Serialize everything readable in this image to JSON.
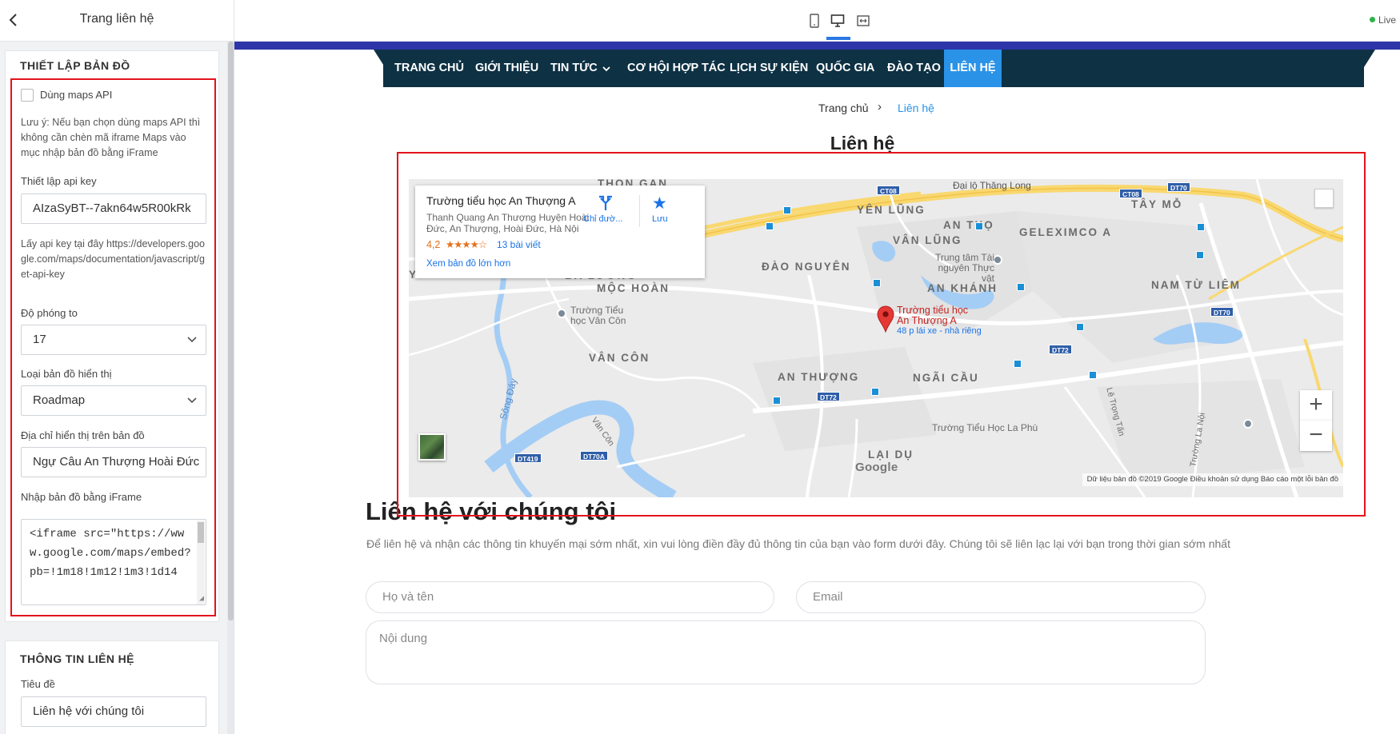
{
  "left_panel": {
    "back_icon": "chevron-left-icon",
    "title": "Trang liên hệ",
    "map_settings": {
      "title": "THIẾT LẬP BẢN ĐỒ",
      "use_api_label": "Dùng maps API",
      "use_api_checked": false,
      "note": "Lưu ý: Nếu bạn chọn dùng maps API thì không cần chèn mã iframe Maps vào mục nhập bản đồ bằng iFrame",
      "api_key_label": "Thiết lập api key",
      "api_key_value": "AIzaSyBT--7akn64w5R00kRk",
      "api_help": "Lấy api key tại đây https://developers.google.com/maps/documentation/javascript/get-api-key",
      "zoom_label": "Độ phóng to",
      "zoom_value": "17",
      "map_type_label": "Loại bản đồ hiển thị",
      "map_type_value": "Roadmap",
      "address_label": "Địa chỉ hiển thị trên bản đồ",
      "address_value": "Ngự Câu An Thượng Hoài Đức",
      "iframe_label": "Nhập bản đồ bằng iFrame",
      "iframe_value": "<iframe src=\"https://www.google.com/maps/embed?pb=!1m18!1m12!1m3!1d14"
    },
    "contact_info": {
      "title": "THÔNG TIN LIÊN HỆ",
      "heading_label": "Tiêu đề",
      "heading_value": "Liên hệ với chúng tôi"
    }
  },
  "toolbar": {
    "devices": [
      "mobile-icon",
      "desktop-icon",
      "fullwidth-icon"
    ],
    "active_device": "desktop-icon",
    "status": "Live",
    "status_color": "#2db34a"
  },
  "site": {
    "nav": [
      "TRANG CHỦ",
      "GIỚI THIỆU",
      "TIN TỨC",
      "CƠ HỘI HỢP TÁC",
      "LỊCH SỰ KIỆN",
      "QUỐC GIA",
      "ĐÀO TẠO",
      "LIÊN HỆ"
    ],
    "nav_active": "LIÊN HỆ",
    "nav_color": "#0e3144",
    "nav_active_color": "#2a93e8",
    "breadcrumb": {
      "home": "Trang chủ",
      "separator": "›",
      "current": "Liên hệ"
    },
    "page_title": "Liên hệ",
    "map": {
      "place_name": "Trường tiểu học An Thượng A",
      "address": "Thanh Quang An Thượng Huyện Hoài Đức, An Thượng, Hoài Đức, Hà Nội",
      "rating": "4,2",
      "stars": "★★★★☆",
      "reviews": "13 bài viết",
      "larger_map": "Xem bản đồ lớn hơn",
      "directions": "Chỉ đườ...",
      "save": "Lưu",
      "pin_label_1": "Trường tiểu học",
      "pin_label_2": "An Thượng A",
      "pin_sub": "48 p lái xe - nhà riêng",
      "labels": [
        "THÔN GẠN",
        "YÊN LŨNG",
        "AN THỌ",
        "GELEXIMCO A",
        "TÂY MỖ",
        "VÂN LŨNG",
        "ĐÀO NGUYÊN",
        "YÊN SƠN",
        "BA LƯƠNG",
        "MỘC HOÀN",
        "AN KHÁNH",
        "NAM TỪ LIÊM",
        "VÂN CÔN",
        "AN THƯỢNG",
        "NGÃI CẦU",
        "LẠI DỤ"
      ],
      "small_labels": [
        "Đại lộ Thăng Long",
        "Trung tâm Tài nguyên Thực vật",
        "Trường Tiểu học Vân Côn",
        "Trường Tiểu Học La Phù",
        "Sông Đáy",
        "Vân Côn",
        "Lê Trọng Tấn",
        "Trường La Nội"
      ],
      "road_shields": [
        "CT08",
        "CT08",
        "DT70",
        "DT70",
        "DT72",
        "DT72",
        "DT419",
        "DT70A"
      ],
      "google": "Google",
      "attribution": "Dữ liệu bản đồ ©2019 Google   Điều khoản sử dụng   Báo cáo một lỗi bản đồ",
      "zoom_in": "+",
      "zoom_out": "−"
    },
    "contact": {
      "heading": "Liên hệ với chúng tôi",
      "description": "Để liên hệ và nhận các thông tin khuyến mại sớm nhất, xin vui lòng điền đầy đủ thông tin của bạn vào form dưới đây. Chúng tôi sẽ liên lạc lại với bạn trong thời gian sớm nhất",
      "name_placeholder": "Họ và tên",
      "email_placeholder": "Email",
      "message_placeholder": "Nội dung"
    }
  }
}
